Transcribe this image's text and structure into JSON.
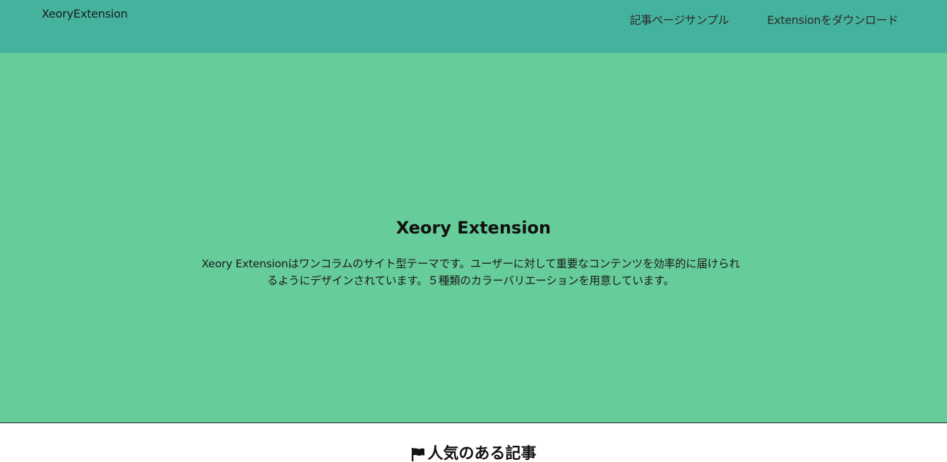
{
  "header": {
    "logo": "XeoryExtension",
    "nav": [
      {
        "label": "記事ページサンプル"
      },
      {
        "label": "Extensionをダウンロード"
      }
    ],
    "background_color": "#45b29d"
  },
  "hero": {
    "title": "Xeory Extension",
    "description_line1": "Xeory Extensionはワンコラムのサイト型テーマです。ユーザーに対して重要なコンテンツを効率的に届けられ",
    "description_line2": "るようにデザインされています。５種類のカラーバリエーションを用意しています。",
    "background_color": "#66cc99"
  },
  "popular": {
    "icon": "flag-icon",
    "title": "人気のある記事"
  }
}
